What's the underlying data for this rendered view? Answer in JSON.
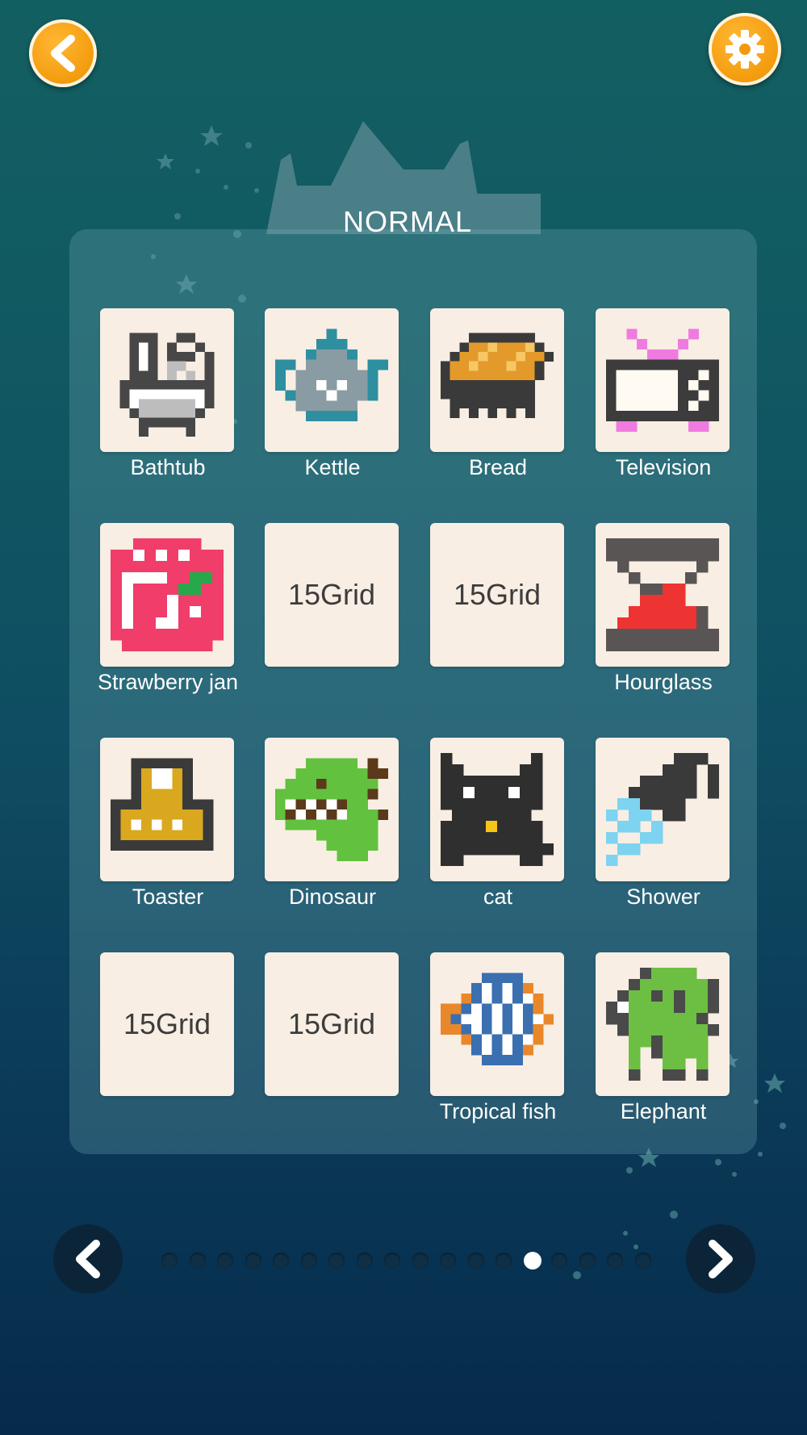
{
  "header": {
    "back_icon": "chevron-left-icon",
    "settings_icon": "gear-icon"
  },
  "level": {
    "title": "NORMAL"
  },
  "puzzles": [
    {
      "label": "Bathtub",
      "type": "image",
      "icon": "bathtub-icon"
    },
    {
      "label": "Kettle",
      "type": "image",
      "icon": "kettle-icon"
    },
    {
      "label": "Bread",
      "type": "image",
      "icon": "bread-icon"
    },
    {
      "label": "Television",
      "type": "image",
      "icon": "television-icon"
    },
    {
      "label": "Strawberry jan",
      "type": "image",
      "icon": "strawberry-jam-icon"
    },
    {
      "label": "",
      "type": "locked",
      "grid_text": "15Grid"
    },
    {
      "label": "",
      "type": "locked",
      "grid_text": "15Grid"
    },
    {
      "label": "Hourglass",
      "type": "image",
      "icon": "hourglass-icon"
    },
    {
      "label": "Toaster",
      "type": "image",
      "icon": "toaster-icon"
    },
    {
      "label": "Dinosaur",
      "type": "image",
      "icon": "dinosaur-icon"
    },
    {
      "label": "cat",
      "type": "image",
      "icon": "cat-icon"
    },
    {
      "label": "Shower",
      "type": "image",
      "icon": "shower-icon"
    },
    {
      "label": "",
      "type": "locked",
      "grid_text": "15Grid"
    },
    {
      "label": "",
      "type": "locked",
      "grid_text": "15Grid"
    },
    {
      "label": "Tropical fish",
      "type": "image",
      "icon": "tropical-fish-icon"
    },
    {
      "label": "Elephant",
      "type": "image",
      "icon": "elephant-icon"
    }
  ],
  "pagination": {
    "total_pages": 18,
    "current_page": 14,
    "prev_icon": "chevron-left-icon",
    "next_icon": "chevron-right-icon"
  },
  "colors": {
    "accent": "#f39a0c",
    "tile_bg": "#f8eee3"
  }
}
